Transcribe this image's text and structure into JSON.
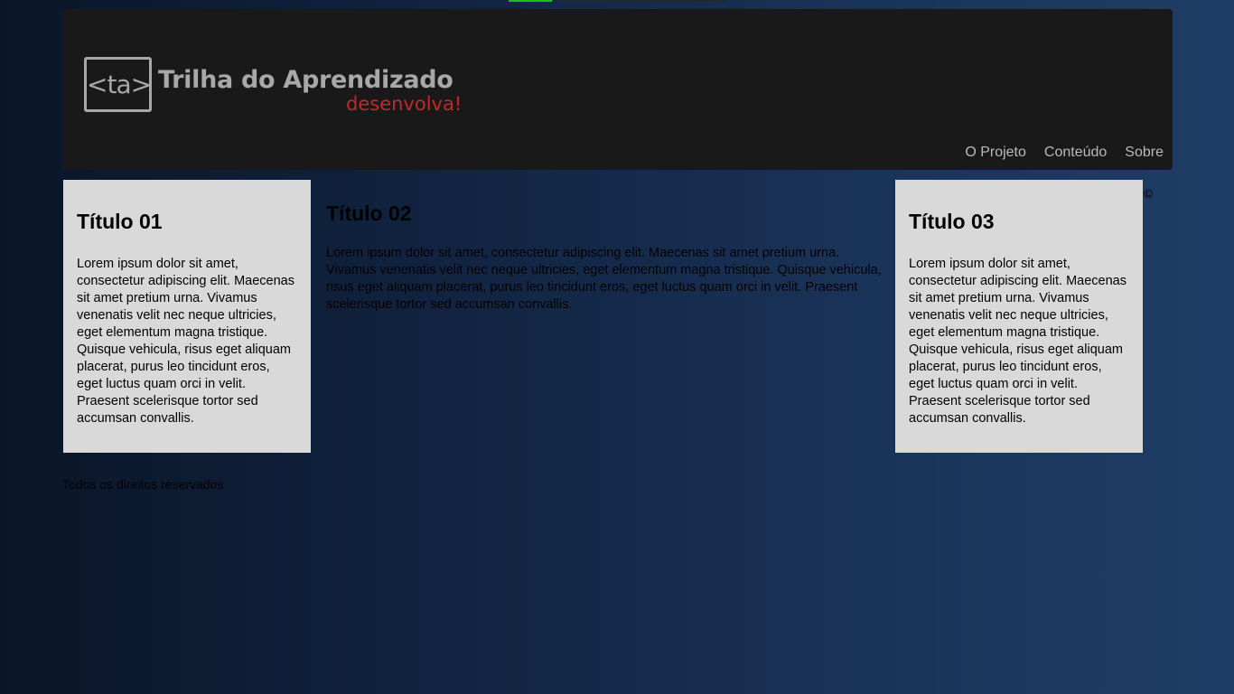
{
  "header": {
    "logo_mark": "<ta>",
    "logo_title": "Trilha do Aprendizado",
    "logo_tagline": "desenvolva!",
    "nav": [
      "O Projeto",
      "Conteúdo",
      "Sobre"
    ]
  },
  "columns": [
    {
      "title": "Título 01",
      "text": "Lorem ipsum dolor sit amet, consectetur adipiscing elit. Maecenas sit amet pretium urna. Vivamus venenatis velit nec neque ultricies, eget elementum magna tristique. Quisque vehicula, risus eget aliquam placerat, purus leo tincidunt eros, eget luctus quam orci in velit. Praesent scelerisque tortor sed accumsan convallis."
    },
    {
      "title": "Título 02",
      "text": "Lorem ipsum dolor sit amet, consectetur adipiscing elit. Maecenas sit amet pretium urna. Vivamus venenatis velit nec neque ultricies, eget elementum magna tristique. Quisque vehicula, risus eget aliquam placerat, purus leo tincidunt eros, eget luctus quam orci in velit. Praesent scelerisque tortor sed accumsan convallis."
    },
    {
      "title": "Título 03",
      "text": "Lorem ipsum dolor sit amet, consectetur adipiscing elit. Maecenas sit amet pretium urna. Vivamus venenatis velit nec neque ultricies, eget elementum magna tristique. Quisque vehicula, risus eget aliquam placerat, purus leo tincidunt eros, eget luctus quam orci in velit. Praesent scelerisque tortor sed accumsan convallis."
    }
  ],
  "copyright_symbol": "©",
  "footer": {
    "text": "Todos os direitos reservados"
  },
  "colors": {
    "header_bg": "#191919",
    "logo_gray": "#a8a8a8",
    "tagline_red": "#c4262e",
    "box_bg": "#d9d9d9",
    "progress_green": "#18c21b"
  }
}
